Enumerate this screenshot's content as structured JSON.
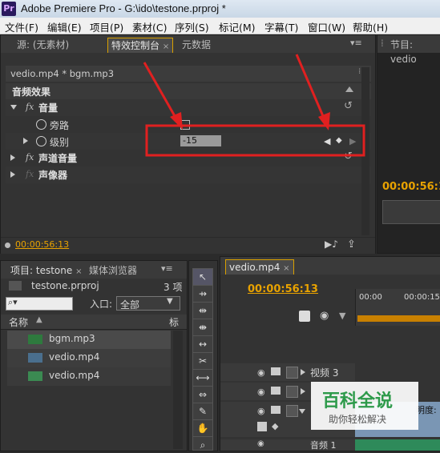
{
  "window": {
    "app_icon": "Pr",
    "title": "Adobe Premiere Pro - G:\\ido\\testone.prproj *"
  },
  "menu": [
    "文件(F)",
    "编辑(E)",
    "项目(P)",
    "素材(C)",
    "序列(S)",
    "标记(M)",
    "字幕(T)",
    "窗口(W)",
    "帮助(H)"
  ],
  "effect_panel": {
    "tabs": [
      "源: (无素材)",
      "特效控制台",
      "元数据"
    ],
    "active_tab": "特效控制台",
    "clip_label": "vedio.mp4 * bgm.mp3",
    "section_title": "音频效果",
    "volume_label": "音量",
    "bypass_label": "旁路",
    "level_label": "级别",
    "level_value": "-15",
    "channel_volume_label": "声道音量",
    "panner_label": "声像器",
    "timecode": "00:00:56:13"
  },
  "program_panel": {
    "tab": "节目: vedio",
    "timecode": "00:00:56:1"
  },
  "project_panel": {
    "tabs": [
      "项目: testone",
      "媒体浏览器"
    ],
    "project_file": "testone.prproj",
    "item_count": "3 项",
    "search_placeholder": "",
    "entry_label": "入口:",
    "entry_value": "全部",
    "column_name": "名称",
    "column_tag": "标",
    "items": [
      "bgm.mp3",
      "vedio.mp4",
      "vedio.mp4"
    ]
  },
  "timeline": {
    "tab": "vedio.mp4",
    "timecode": "00:00:56:13",
    "ruler": [
      "00:00",
      "00:00:15:"
    ],
    "tracks": [
      "视频 3",
      "",
      "",
      "音频 1"
    ],
    "opacity_label": "明度:"
  },
  "watermark": {
    "title": "百科全说",
    "subtitle": "助你轻松解决"
  },
  "colors": {
    "accent": "#e8a200",
    "annotation": "#e02020",
    "active_tab_border": "#d9a000"
  }
}
